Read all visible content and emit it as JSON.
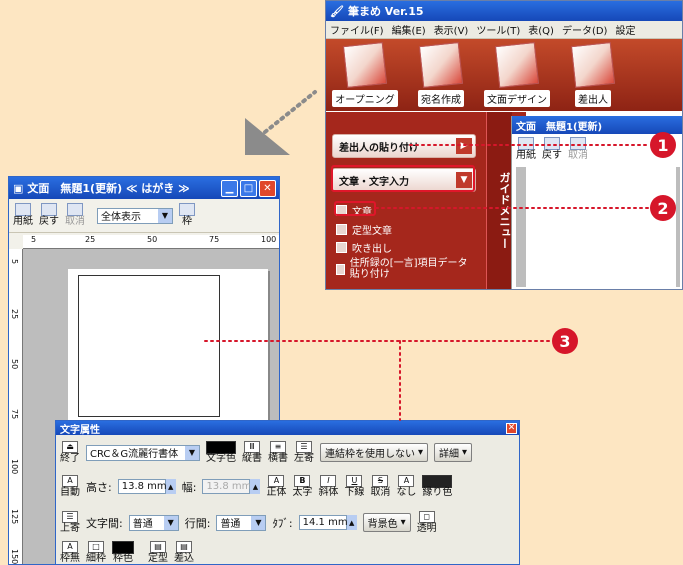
{
  "app": {
    "title": "筆まめ Ver.15",
    "menu": [
      "ファイル(F)",
      "編集(E)",
      "表示(V)",
      "ツール(T)",
      "表(Q)",
      "データ(D)",
      "設定"
    ],
    "toolbar": [
      "オープニング",
      "宛名作成",
      "文面デザイン",
      "差出人"
    ],
    "guide_tab": "ガイドメニュー",
    "guide_buttons": [
      "差出人の貼り付け",
      "文章・文字入力"
    ],
    "guide_items": [
      "文章",
      "定型文章",
      "吹き出し",
      "住所録の[一言]項目データ貼り付け"
    ],
    "doc_title": "文面　無題1(更新)",
    "doc_tools": [
      "用紙",
      "戻す",
      "取消"
    ]
  },
  "main": {
    "title": "文面　無題1(更新) ≪ はがき ≫",
    "tools": [
      "用紙",
      "戻す",
      "取消",
      "枠"
    ],
    "zoom": "全体表示",
    "ruler_h": [
      "5",
      "25",
      "50",
      "75",
      "100"
    ],
    "ruler_v": [
      "5",
      "25",
      "50",
      "75",
      "100",
      "125",
      "150"
    ]
  },
  "attr": {
    "title": "文字属性",
    "end": "終了",
    "font": "CRC＆G流麗行書体",
    "color": "文字色",
    "vertical": "縦書",
    "horizontal": "横書",
    "align": "左寄",
    "linked": "連結枠を使用しない",
    "detail": "詳細",
    "auto": "自動",
    "height_label": "高さ:",
    "height_value": "13.8 mm",
    "width_label": "幅:",
    "width_value": "13.8 mm",
    "normal": "正体",
    "bold": "太字",
    "italic": "斜体",
    "underline": "下線",
    "strike": "取消",
    "none": "なし",
    "fringe": "縁り色",
    "top": "上寄",
    "char_spacing_label": "文字間:",
    "char_spacing": "普通",
    "line_spacing_label": "行間:",
    "line_spacing": "普通",
    "tab_label": "ﾀﾌﾞ:",
    "tab_value": "14.1 mm",
    "bg_color": "背景色",
    "transparent": "透明",
    "no_frame": "枠無",
    "thin_frame": "細枠",
    "frame_color": "枠色",
    "fixed": "定型",
    "insert": "差込"
  },
  "callouts": [
    "1",
    "2",
    "3"
  ]
}
